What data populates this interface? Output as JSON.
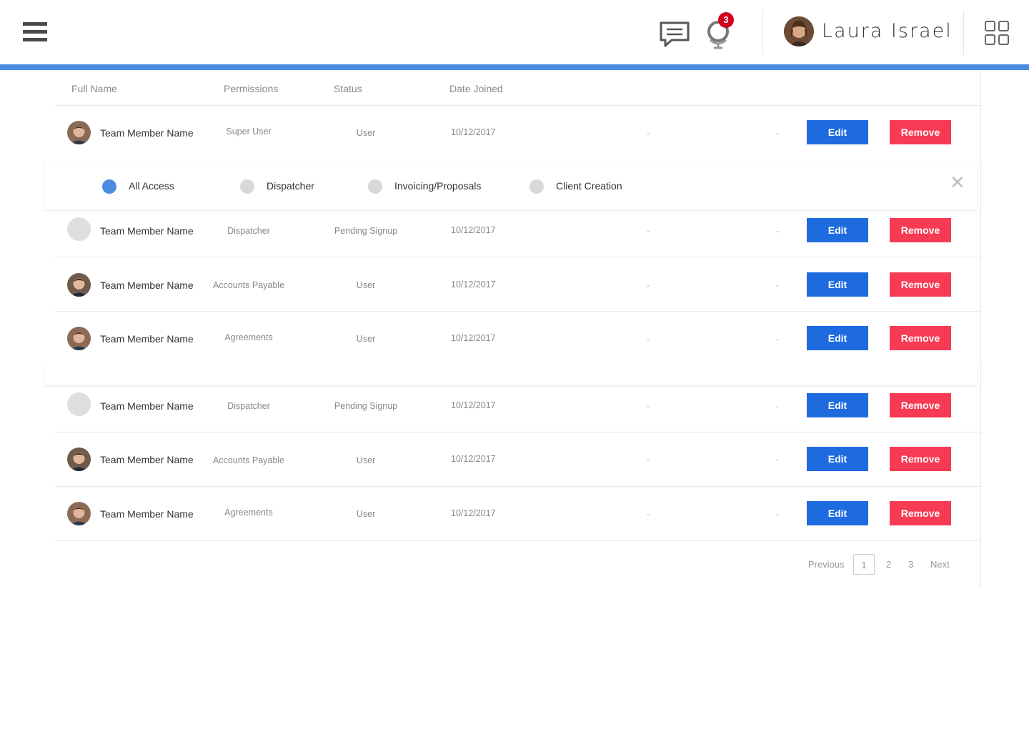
{
  "header": {
    "user_name": "Laura Israel",
    "notification_count": "3",
    "accent_color": "#4a8be0"
  },
  "table": {
    "columns": [
      "Full Name",
      "Permissions",
      "Status",
      "Date Joined"
    ],
    "rows": [
      {
        "name": "Team Member Name",
        "permission": "Super User",
        "status": "User",
        "date": "10/12/2017",
        "col5": "-",
        "col6": "-",
        "edit": "Edit",
        "remove": "Remove"
      },
      {
        "name": "Team Member Name",
        "permission": "Dispatcher",
        "status": "Pending Signup",
        "date": "10/12/2017",
        "col5": "-",
        "col6": "-",
        "edit": "Edit",
        "remove": "Remove"
      },
      {
        "name": "Team Member Name",
        "permission": "Accounts Payable",
        "status": "User",
        "date": "10/12/2017",
        "col5": "-",
        "col6": "-",
        "edit": "Edit",
        "remove": "Remove"
      },
      {
        "name": "Team Member Name",
        "permission": "Agreements",
        "status": "User",
        "date": "10/12/2017",
        "col5": "-",
        "col6": "-",
        "edit": "Edit",
        "remove": "Remove"
      },
      {
        "name": "Team Member Name",
        "permission": "Dispatcher",
        "status": "Pending Signup",
        "date": "10/12/2017",
        "col5": "-",
        "col6": "-",
        "edit": "Edit",
        "remove": "Remove"
      },
      {
        "name": "Team Member Name",
        "permission": "Accounts Payable",
        "status": "User",
        "date": "10/12/2017",
        "col5": "-",
        "col6": "-",
        "edit": "Edit",
        "remove": "Remove"
      },
      {
        "name": "Team Member Name",
        "permission": "Agreements",
        "status": "User",
        "date": "10/12/2017",
        "col5": "-",
        "col6": "-",
        "edit": "Edit",
        "remove": "Remove"
      }
    ]
  },
  "permission_panel": {
    "options": [
      {
        "label": "All Access",
        "selected": true
      },
      {
        "label": "Dispatcher",
        "selected": false
      },
      {
        "label": "Invoicing/Proposals",
        "selected": false
      },
      {
        "label": "Client Creation",
        "selected": false
      }
    ],
    "close_icon": "close-icon"
  },
  "pagination": {
    "previous": "Previous",
    "pages": [
      "1",
      "2",
      "3"
    ],
    "current": "1",
    "next": "Next"
  }
}
